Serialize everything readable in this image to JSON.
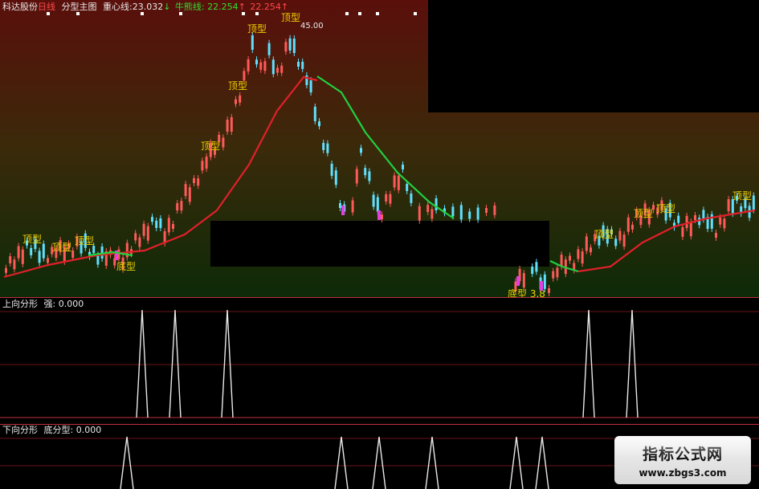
{
  "main_header": {
    "stock": "科达股份",
    "period": "日线",
    "indicator": "分型主图",
    "zx_label": "重心线:",
    "zx_value": "23.032",
    "zx_arrow": "↓",
    "nx_label": "牛熊线:",
    "nx_value1": "22.254",
    "nx_arrow1": "↑",
    "nx_value2": "22.254",
    "nx_arrow2": "↑"
  },
  "price_labels": {
    "top": "顶型",
    "bottom": "底型",
    "high_value": "45.00",
    "bottom_extra": "底型 3.8"
  },
  "panel2_header": {
    "name": "上向分形",
    "label": "强:",
    "value": "0.000"
  },
  "panel3_header": {
    "name": "下向分形",
    "label": "底分型:",
    "value": "0.000"
  },
  "watermark": {
    "title": "指标公式网",
    "url": "www.zbgs3.com"
  },
  "colors": {
    "up_candle": "#ff5a5a",
    "down_candle": "#5fe0ff",
    "center_line": "#e0202a",
    "bullbear_line": "#20d040",
    "label": "#f0d000",
    "magenta": "#e040e0",
    "separator": "#c0303a"
  }
}
